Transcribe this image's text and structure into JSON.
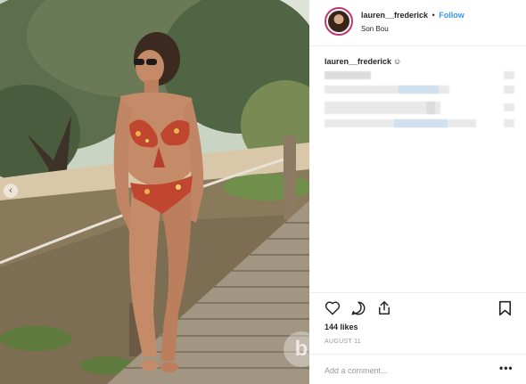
{
  "post": {
    "username": "lauren__frederick",
    "separator": "•",
    "follow_label": "Follow",
    "location": "Son Bou",
    "caption_username": "lauren__frederick",
    "caption_emoji": "☺",
    "likes": "144 likes",
    "date": "AUGUST 11",
    "comment_placeholder": "Add a comment...",
    "more_label": "•••",
    "watermark": "b"
  },
  "nav": {
    "prev_label": "‹"
  },
  "icons": {
    "like": "heart-icon",
    "comment": "comment-icon",
    "share": "share-icon",
    "save": "bookmark-icon",
    "avatar": "avatar",
    "prev": "chevron-left-icon"
  },
  "colors": {
    "link": "#3897f0",
    "text": "#262626",
    "muted": "#999999",
    "divider": "#efefef",
    "story_ring": "#c1356e"
  }
}
